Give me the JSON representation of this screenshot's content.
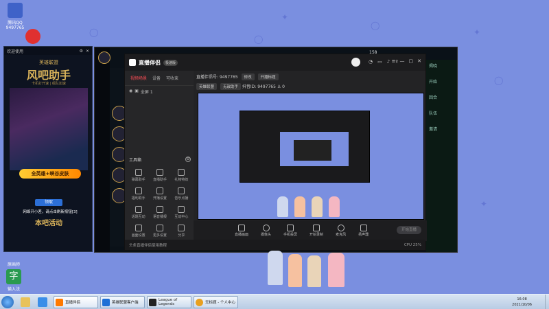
{
  "desktop": {
    "icons": [
      {
        "label": "腾讯QQ",
        "sub": "9497765",
        "color": "#3f62c8"
      },
      {
        "label": "",
        "color": "#e03030"
      },
      {
        "label": "原画师",
        "color": "#4a77d8"
      },
      {
        "label": "输入法",
        "glyph": "字",
        "color": "#2a9a50"
      }
    ]
  },
  "left_window": {
    "title": "欢迎使用",
    "ad_top": "英雄联盟",
    "ad_title": "风吧助手",
    "ad_line": "卡机打开速 | 组队加速",
    "ad_badge": "全英雄+峡谷皮肤",
    "ad_button": "领取",
    "ad_notice": "网络开小差，请点击刷新按钮[3]",
    "ad_footer": "本吧活动",
    "status": "实时运行时"
  },
  "lol_window": {
    "coin_blue": "158",
    "coin_orange": "",
    "right_labels": [
      "揭晓",
      "开始",
      "回合",
      "队伍",
      "邀请"
    ]
  },
  "stream_app": {
    "name": "直播伴侣",
    "version": "极速版",
    "tabs": [
      "视频场景",
      "设备",
      "可收束"
    ],
    "active_tab": 0,
    "scene": "全屏 1",
    "info": {
      "room_label": "直播伴侣号",
      "room_id": "9497765",
      "edit": "修改",
      "live_title": "开播标题",
      "category": "英雄联盟",
      "tag": "无敌助手",
      "account_label": "抖音ID",
      "account": "9497765",
      "online": "0"
    },
    "tools_title": "工具箱",
    "tools": [
      "弹幕助手",
      "直播助手",
      "礼物特效",
      "福利助手",
      "开播设置",
      "音乐点播",
      "话题互动",
      "语音播报",
      "互动中心",
      "画面设置",
      "更多设置",
      "分享"
    ],
    "bottom_actions": [
      "直播画面",
      "摄像头",
      "手机投屏",
      "开始录制",
      "麦克风",
      "扬声器"
    ],
    "start_live": "开始直播",
    "status_left": "头条直播伴侣使用教程",
    "status_right": "CPU 25%"
  },
  "taskbar": {
    "tasks": [
      {
        "label": "直播伴侣",
        "color": "#ff7a00",
        "active": true
      },
      {
        "label": "英雄联盟客户端",
        "color": "#1d6fd6",
        "active": false
      },
      {
        "label": "League of Legends",
        "color": "#222",
        "active": false
      },
      {
        "label": "无标题 - 个人中心",
        "color": "#e8a020",
        "active": false
      }
    ],
    "time": "16:08",
    "date": "2021/10/06"
  }
}
